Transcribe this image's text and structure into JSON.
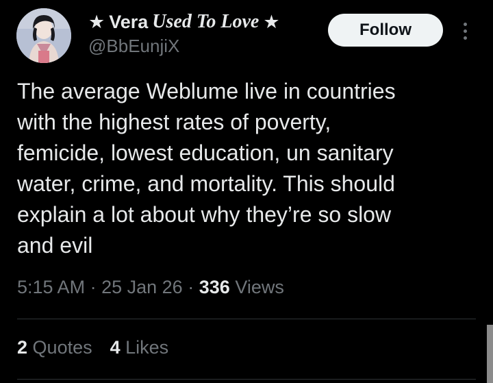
{
  "author": {
    "star_left": "★",
    "name": "Vera",
    "name_styled": "Used To Love",
    "star_right": "★",
    "handle": "@BbEunjiX"
  },
  "follow_label": "Follow",
  "tweet": {
    "lines": [
      "The average Weblume live in countries",
      "with the highest rates of poverty,",
      "femicide, lowest education, un sanitary",
      "water, crime, and mortality.  This should",
      "explain a lot about why they’re so slow",
      "and evil"
    ]
  },
  "meta": {
    "time": "5:15 AM",
    "sep1": "·",
    "date": "25 Jan 26",
    "sep2": "·",
    "views_count": "336",
    "views_label": "Views"
  },
  "stats": {
    "quotes_count": "2",
    "quotes_label": "Quotes",
    "likes_count": "4",
    "likes_label": "Likes"
  },
  "colors": {
    "background": "#000000",
    "text": "#e7e9ea",
    "secondary": "#71767b",
    "divider": "#2f3336",
    "follow_bg": "#eff3f4"
  }
}
